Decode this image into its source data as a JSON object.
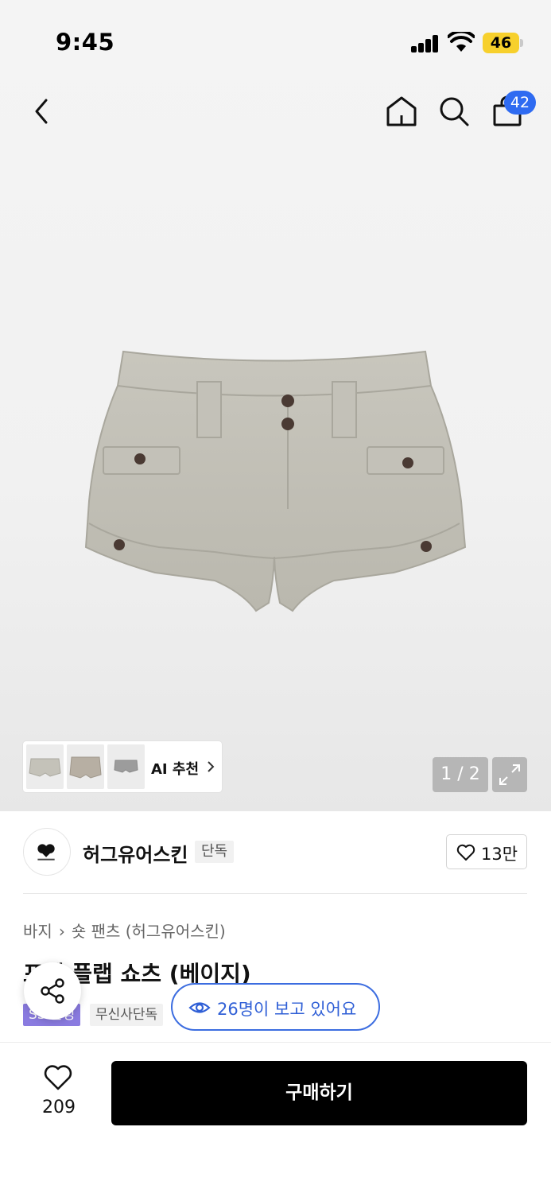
{
  "status_bar": {
    "time": "9:45",
    "battery": "46"
  },
  "nav": {
    "cart_count": "42"
  },
  "gallery": {
    "ai_label": "AI 추천",
    "pager": "1 / 2"
  },
  "brand": {
    "name": "허그유어스킨",
    "tag": "단독",
    "likes": "13만"
  },
  "product": {
    "breadcrumb": [
      "바지",
      "숏 팬츠 (허그유어스킨)"
    ],
    "title": "포켓 플랩 쇼츠 (베이지)",
    "tags": [
      "SS 한정",
      "무신사단독"
    ],
    "viewers": "26명이 보고 있어요"
  },
  "bottom_bar": {
    "like_count": "209",
    "buy_label": "구매하기"
  }
}
